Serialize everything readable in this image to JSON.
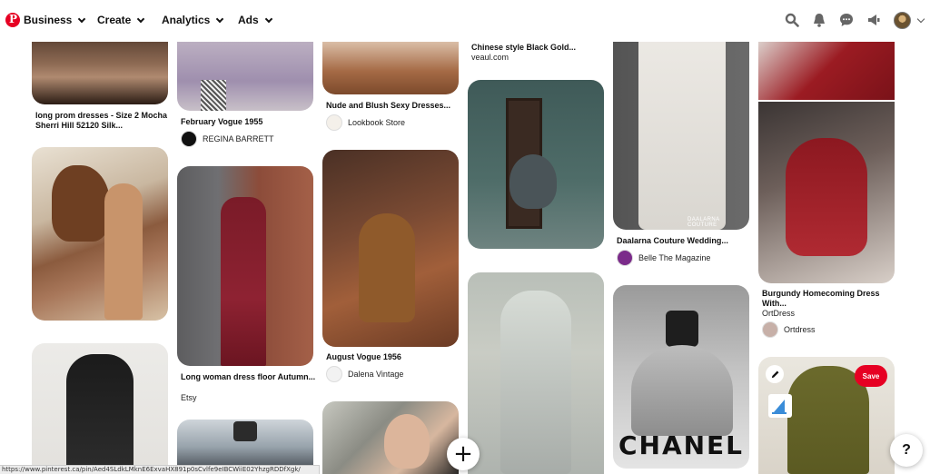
{
  "header": {
    "nav": [
      {
        "label": "Business"
      },
      {
        "label": "Create"
      },
      {
        "label": "Analytics"
      },
      {
        "label": "Ads"
      }
    ]
  },
  "pins": {
    "p1": {
      "title": "long prom dresses - Size 2 Mocha Sherri Hill 52120 Silk..."
    },
    "p2": {
      "title": "February Vogue 1955",
      "user": "REGINA BARRETT"
    },
    "p3": {
      "title": "Nude and Blush Sexy Dresses...",
      "user": "Lookbook Store"
    },
    "p4": {
      "title": "Chinese style Black Gold...",
      "domain": "veaul.com"
    },
    "p5": {
      "title": "Long woman dress floor Autumn...",
      "sub": "Etsy"
    },
    "p6": {
      "title": "August Vogue 1956",
      "user": "Dalena Vintage"
    },
    "p7": {
      "title": "Daalarna Couture Wedding...",
      "user": "Belle The Magazine",
      "watermark": "DAALARNA COUTURE"
    },
    "p8": {
      "title": "Burgundy Homecoming Dress With...",
      "sub": "OrtDress",
      "user": "Ortdress"
    },
    "p9": {
      "brand_text": "CHANEL"
    }
  },
  "buttons": {
    "save": "Save",
    "add": "+",
    "help": "?"
  },
  "status_url": "https://www.pinterest.ca/pin/Aed4SLdkLMknE6ExvaHX891p0sCvlfe9eIBCWiiE02YhzgRDDfXgk/",
  "colors": {
    "brand": "#e60023"
  },
  "icons": [
    "pinterest-logo-icon",
    "search-icon",
    "bell-icon",
    "chat-icon",
    "megaphone-icon",
    "chevron-down-icon",
    "pencil-icon",
    "plus-icon",
    "help-icon"
  ]
}
